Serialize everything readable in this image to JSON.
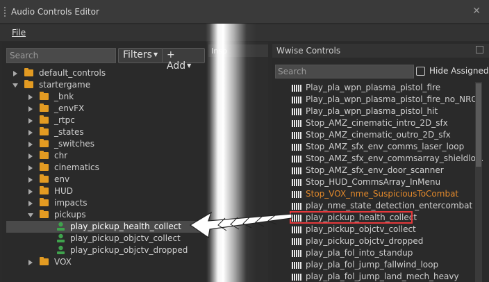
{
  "window": {
    "title": "Audio Controls Editor"
  },
  "menu": {
    "file": "File"
  },
  "left": {
    "search_placeholder": "Search",
    "filters_label": "Filters",
    "add_label": "+ Add",
    "tree": [
      {
        "label": "default_controls",
        "expanded": false,
        "depth": 0,
        "type": "folder"
      },
      {
        "label": "startergame",
        "expanded": true,
        "depth": 0,
        "type": "folder"
      },
      {
        "label": "_bnk",
        "expanded": false,
        "depth": 1,
        "type": "folder"
      },
      {
        "label": "_envFX",
        "expanded": false,
        "depth": 1,
        "type": "folder"
      },
      {
        "label": "_rtpc",
        "expanded": false,
        "depth": 1,
        "type": "folder"
      },
      {
        "label": "_states",
        "expanded": false,
        "depth": 1,
        "type": "folder"
      },
      {
        "label": "_switches",
        "expanded": false,
        "depth": 1,
        "type": "folder"
      },
      {
        "label": "chr",
        "expanded": false,
        "depth": 1,
        "type": "folder"
      },
      {
        "label": "cinematics",
        "expanded": false,
        "depth": 1,
        "type": "folder"
      },
      {
        "label": "env",
        "expanded": false,
        "depth": 1,
        "type": "folder"
      },
      {
        "label": "HUD",
        "expanded": false,
        "depth": 1,
        "type": "folder"
      },
      {
        "label": "impacts",
        "expanded": false,
        "depth": 1,
        "type": "folder"
      },
      {
        "label": "pickups",
        "expanded": true,
        "depth": 1,
        "type": "folder"
      },
      {
        "label": "play_pickup_health_collect",
        "depth": 2,
        "type": "trigger",
        "selected": true
      },
      {
        "label": "play_pickup_objctv_collect",
        "depth": 2,
        "type": "trigger"
      },
      {
        "label": "play_pickup_objctv_dropped",
        "depth": 2,
        "type": "trigger"
      },
      {
        "label": "VOX",
        "expanded": false,
        "depth": 1,
        "type": "folder"
      }
    ]
  },
  "inspector": {
    "title": "Insp"
  },
  "right": {
    "title": "Wwise Controls",
    "search_placeholder": "Search",
    "hide_assigned_label": "Hide Assigned",
    "items": [
      {
        "label": "Play_pla_wpn_plasma_pistol_fire",
        "state": "normal"
      },
      {
        "label": "Play_pla_wpn_plasma_pistol_fire_no_NRG",
        "state": "normal"
      },
      {
        "label": "Play_pla_wpn_plasma_pistol_hit",
        "state": "normal"
      },
      {
        "label": "Stop_AMZ_cinematic_intro_2D_sfx",
        "state": "normal"
      },
      {
        "label": "Stop_AMZ_cinematic_outro_2D_sfx",
        "state": "normal"
      },
      {
        "label": "Stop_AMZ_sfx_env_comms_laser_loop",
        "state": "normal"
      },
      {
        "label": "Stop_AMZ_sfx_env_commsarray_shieldlo...",
        "state": "normal"
      },
      {
        "label": "Stop_AMZ_sfx_env_door_scanner",
        "state": "normal"
      },
      {
        "label": "Stop_HUD_CommsArray_InMenu",
        "state": "normal"
      },
      {
        "label": "Stop_VOX_nme_SuspiciousToCombat",
        "state": "unassigned"
      },
      {
        "label": "play_nme_state_detection_entercombat",
        "state": "normal"
      },
      {
        "label": "play_pickup_health_collect",
        "state": "highlighted"
      },
      {
        "label": "play_pickup_objctv_collect",
        "state": "normal"
      },
      {
        "label": "play_pickup_objctv_dropped",
        "state": "normal"
      },
      {
        "label": "play_pla_fol_into_standup",
        "state": "normal"
      },
      {
        "label": "play_pla_fol_jump_fallwind_loop",
        "state": "normal"
      },
      {
        "label": "play_pla_fol_jump_land_mech_heavy",
        "state": "normal"
      }
    ]
  },
  "colors": {
    "folder": "#e39b22",
    "trigger": "#3fa34d",
    "unassigned": "#e3892b",
    "highlight": "#e5383b"
  }
}
